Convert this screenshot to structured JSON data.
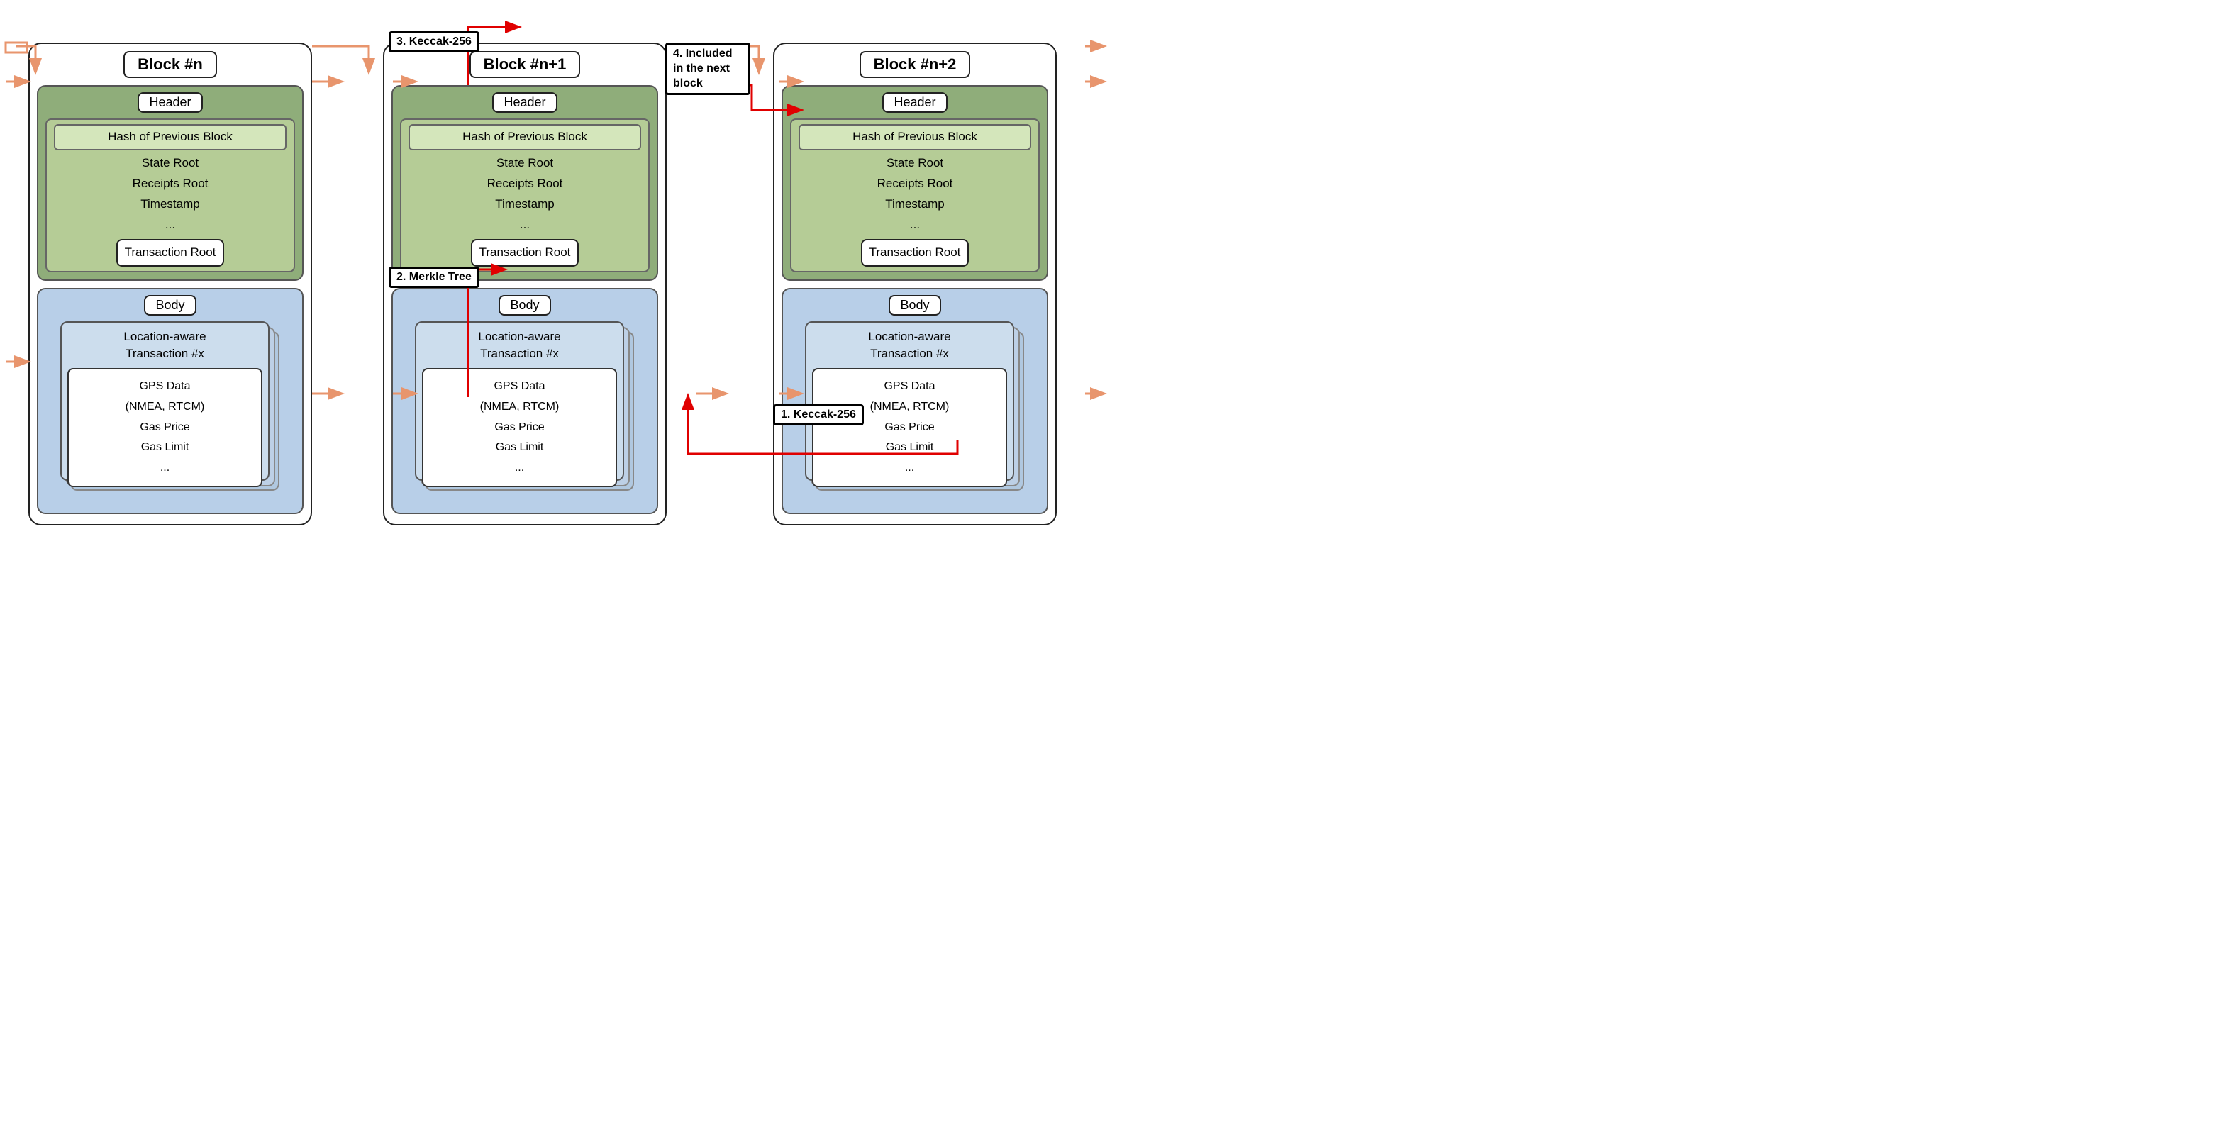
{
  "blocks": [
    {
      "id": "block-n",
      "title": "Block #n",
      "header": {
        "label": "Header",
        "hash_field": "Hash of Previous Block",
        "fields": [
          "State Root",
          "Receipts Root",
          "Timestamp",
          "..."
        ],
        "tx_root": "Transaction Root"
      },
      "body": {
        "label": "Body",
        "tx_title": [
          "Location-aware",
          "Transaction #x"
        ],
        "tx_inner": [
          "GPS Data",
          "(NMEA, RTCM)",
          "Gas Price",
          "Gas Limit",
          "..."
        ]
      }
    },
    {
      "id": "block-n1",
      "title": "Block #n+1",
      "header": {
        "label": "Header",
        "hash_field": "Hash of Previous Block",
        "fields": [
          "State Root",
          "Receipts Root",
          "Timestamp",
          "..."
        ],
        "tx_root": "Transaction Root"
      },
      "body": {
        "label": "Body",
        "tx_title": [
          "Location-aware",
          "Transaction #x"
        ],
        "tx_inner": [
          "GPS Data",
          "(NMEA, RTCM)",
          "Gas Price",
          "Gas Limit",
          "..."
        ]
      }
    },
    {
      "id": "block-n2",
      "title": "Block #n+2",
      "header": {
        "label": "Header",
        "hash_field": "Hash of Previous Block",
        "fields": [
          "State Root",
          "Receipts Root",
          "Timestamp",
          "..."
        ],
        "tx_root": "Transaction Root"
      },
      "body": {
        "label": "Body",
        "tx_title": [
          "Location-aware",
          "Transaction #x"
        ],
        "tx_inner": [
          "GPS Data",
          "(NMEA, RTCM)",
          "Gas Price",
          "Gas Limit",
          "..."
        ]
      }
    }
  ],
  "annotations": {
    "keccak1": "1. Keccak-256",
    "merkle2": "2. Merkle Tree",
    "keccak3": "3. Keccak-256",
    "included4": "4. Included in\nthe next block"
  },
  "colors": {
    "red_arrow": "#e00000",
    "peach_arrow": "#f0a080",
    "green_header": "#8fad7a",
    "blue_body": "#b8cfe8"
  }
}
